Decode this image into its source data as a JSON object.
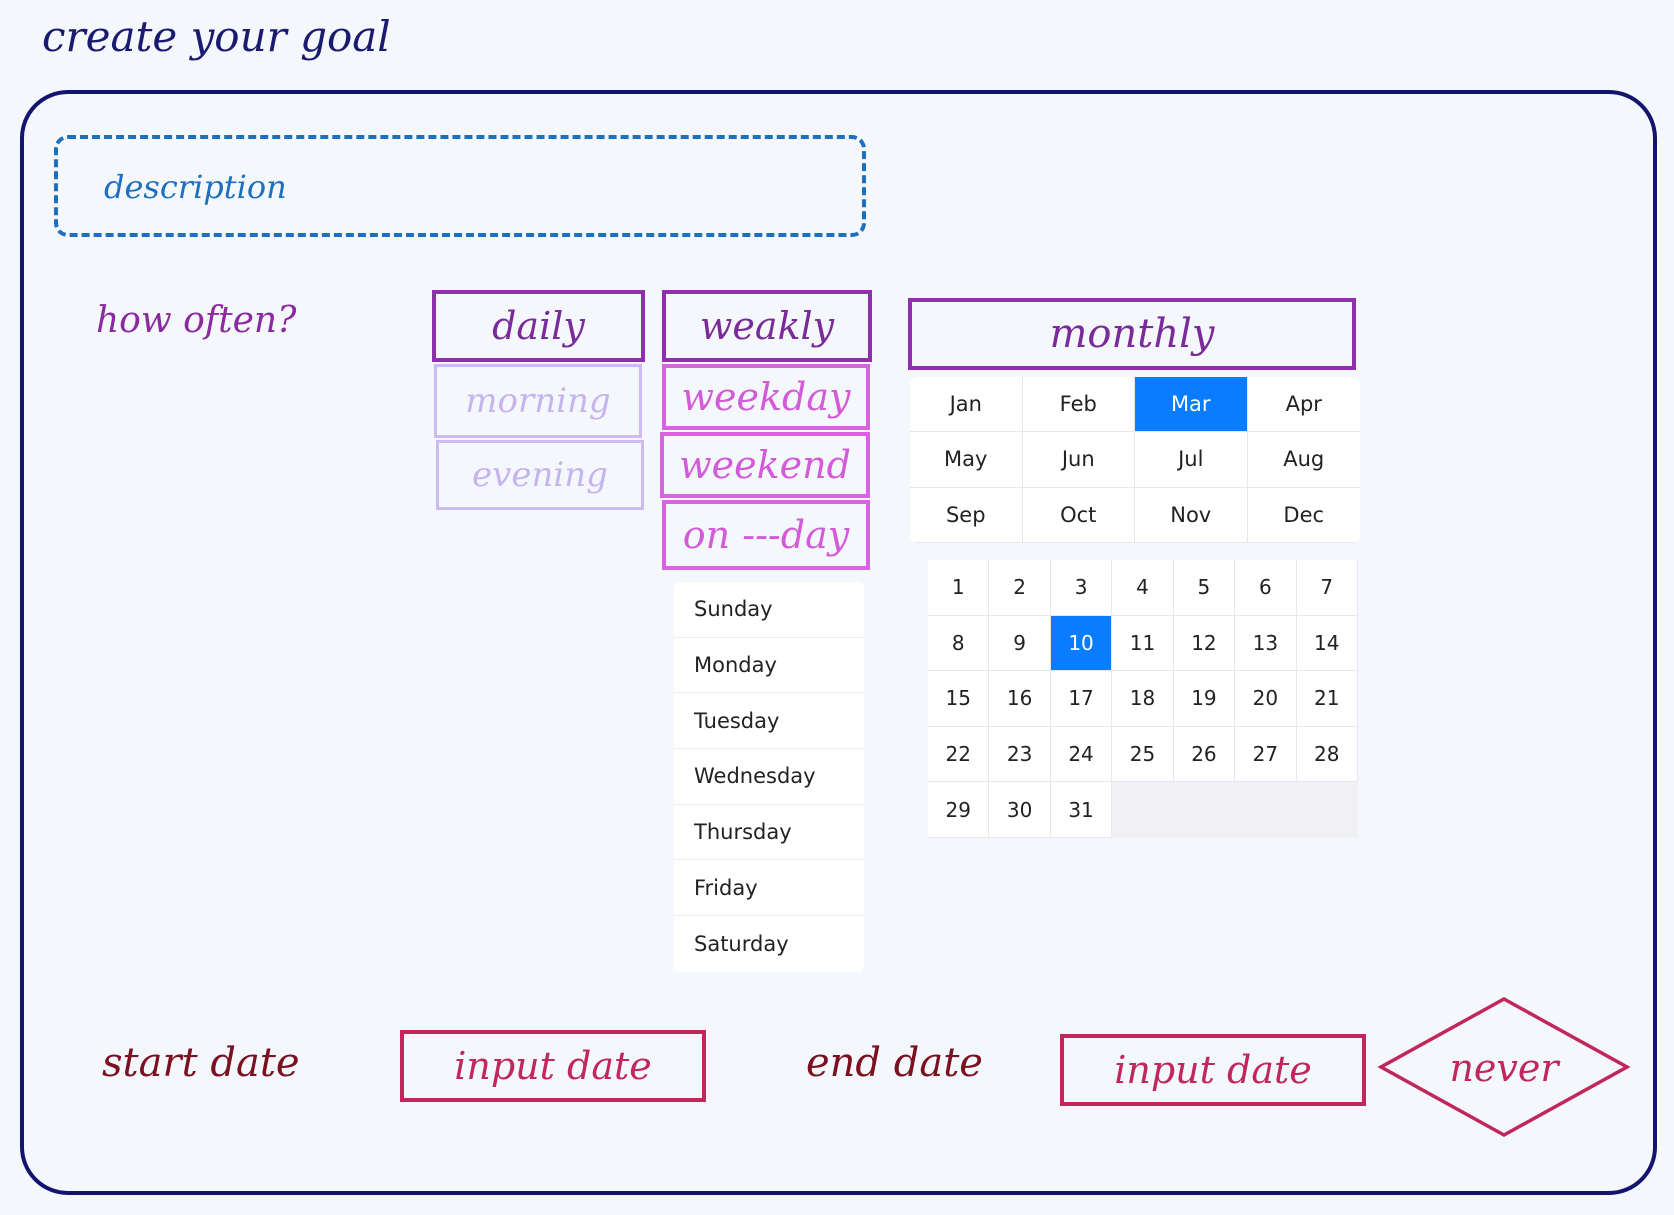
{
  "title": "create your goal",
  "description": {
    "placeholder": "description"
  },
  "frequency": {
    "label": "how often?",
    "daily": "daily",
    "weekly": "weakly",
    "monthly": "monthly",
    "daily_options": [
      "morning",
      "evening"
    ],
    "weekly_options": [
      "weekday",
      "weekend",
      "on ---day"
    ]
  },
  "weekdays": [
    "Sunday",
    "Monday",
    "Tuesday",
    "Wednesday",
    "Thursday",
    "Friday",
    "Saturday"
  ],
  "months": [
    "Jan",
    "Feb",
    "Mar",
    "Apr",
    "May",
    "Jun",
    "Jul",
    "Aug",
    "Sep",
    "Oct",
    "Nov",
    "Dec"
  ],
  "selected_month": "Mar",
  "dates": [
    "1",
    "2",
    "3",
    "4",
    "5",
    "6",
    "7",
    "8",
    "9",
    "10",
    "11",
    "12",
    "13",
    "14",
    "15",
    "16",
    "17",
    "18",
    "19",
    "20",
    "21",
    "22",
    "23",
    "24",
    "25",
    "26",
    "27",
    "28",
    "29",
    "30",
    "31"
  ],
  "selected_date": "10",
  "start": {
    "label": "start date",
    "input_placeholder": "input date"
  },
  "end": {
    "label": "end date",
    "input_placeholder": "input date",
    "never_label": "never"
  },
  "colors": {
    "accent": "#0a7cff",
    "frame": "#14146e",
    "purple": "#8f2fae",
    "pink": "#d862e0",
    "crimson": "#c2275c"
  }
}
